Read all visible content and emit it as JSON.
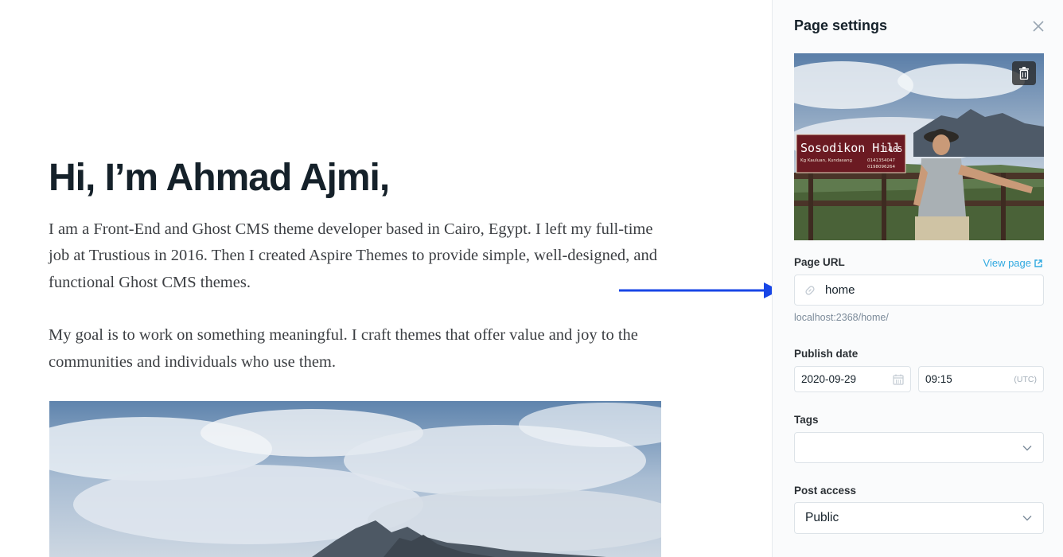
{
  "editor": {
    "title": "Hi, I’m Ahmad Ajmi,",
    "paragraphs": [
      "I am a Front-End and Ghost CMS theme developer based in Cairo, Egypt. I left my full-time job at Trustious in 2016. Then I created Aspire Themes to provide simple, well-designed, and functional Ghost CMS themes.",
      "My goal is to work on something meaningful. I craft themes that offer value and joy to the communities and individuals who use them."
    ]
  },
  "panel": {
    "title": "Page settings",
    "feature_image": {
      "sign_text": "Sosodikon Hill",
      "sign_number": "1465",
      "sign_subtext": "Kg Kauluan, Kundasang",
      "sign_phone_1": "0141354047",
      "sign_phone_2": "0198096264"
    },
    "page_url": {
      "label": "Page URL",
      "view_link": "View page",
      "value": "home",
      "hint": "localhost:2368/home/"
    },
    "publish_date": {
      "label": "Publish date",
      "date": "2020-09-29",
      "time": "09:15",
      "timezone": "(UTC)"
    },
    "tags": {
      "label": "Tags",
      "value": ""
    },
    "post_access": {
      "label": "Post access",
      "value": "Public"
    }
  },
  "colors": {
    "arrow": "#1846e6",
    "link": "#30a9e0",
    "panel_bg": "#fafbfc"
  }
}
